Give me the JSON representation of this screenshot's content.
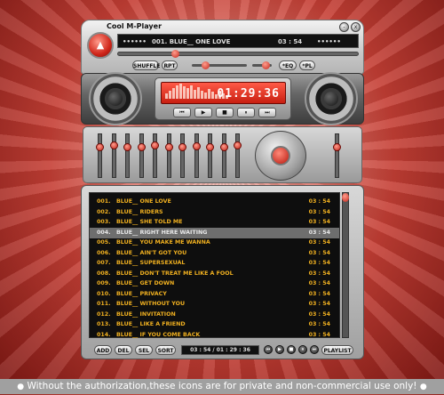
{
  "window": {
    "title": "Cool M-Player",
    "minimize_label": "-",
    "close_label": "x"
  },
  "now_playing": {
    "prefix": "••••••",
    "track_text": "001.  BLUE__  ONE LOVE",
    "time_text": "03 : 54",
    "suffix": "••••••"
  },
  "controls": {
    "shuffle_label": "SHUFFLE",
    "repeat_label": "RPT",
    "eq_label": "*EQ",
    "pl_label": "*PL",
    "eject_icon": "▲",
    "transport": [
      "⏮",
      "▶",
      "■",
      "⏸",
      "⏭"
    ]
  },
  "display": {
    "time": "01:29:36"
  },
  "seek": {
    "position_fraction": 0.23
  },
  "volume": {
    "fraction": 0.2
  },
  "balance": {
    "fraction": 0.85
  },
  "equalizer": {
    "bands": [
      0.25,
      0.2,
      0.25,
      0.25,
      0.2,
      0.25,
      0.25,
      0.22,
      0.25,
      0.25,
      0.2
    ],
    "preamp": 0.25
  },
  "playlist": {
    "tracks": [
      {
        "num": "001.",
        "title": "BLUE__  ONE LOVE",
        "duration": "03 : 54",
        "selected": false
      },
      {
        "num": "002.",
        "title": "BLUE__  RIDERS",
        "duration": "03 : 54",
        "selected": false
      },
      {
        "num": "003.",
        "title": "BLUE__  SHE TOLD ME",
        "duration": "03 : 54",
        "selected": false
      },
      {
        "num": "004.",
        "title": "BLUE__  RIGHT HERE WAITING",
        "duration": "03 : 54",
        "selected": true
      },
      {
        "num": "005.",
        "title": "BLUE__  YOU MAKE ME WANNA",
        "duration": "03 : 54",
        "selected": false
      },
      {
        "num": "006.",
        "title": "BLUE__  AIN'T GOT YOU",
        "duration": "03 : 54",
        "selected": false
      },
      {
        "num": "007.",
        "title": "BLUE__  SUPERSEXUAL",
        "duration": "03 : 54",
        "selected": false
      },
      {
        "num": "008.",
        "title": "BLUE__  DON'T TREAT ME LIKE A FOOL",
        "duration": "03 : 54",
        "selected": false
      },
      {
        "num": "009.",
        "title": "BLUE__  GET DOWN",
        "duration": "03 : 54",
        "selected": false
      },
      {
        "num": "010.",
        "title": "BLUE__  PRIVACY",
        "duration": "03 : 54",
        "selected": false
      },
      {
        "num": "011.",
        "title": "BLUE__  WITHOUT YOU",
        "duration": "03 : 54",
        "selected": false
      },
      {
        "num": "012.",
        "title": "BLUE__  INVITATION",
        "duration": "03 : 54",
        "selected": false
      },
      {
        "num": "013.",
        "title": "BLUE__  LIKE A FRIEND",
        "duration": "03 : 54",
        "selected": false
      },
      {
        "num": "014.",
        "title": "BLUE__  IF YOU COME BACK",
        "duration": "03 : 54",
        "selected": false
      }
    ],
    "scroll_fraction": 0.0,
    "buttons": {
      "add": "ADD",
      "del": "DEL",
      "sel": "SEL",
      "sort": "SORT",
      "playlist": "PLAYLIST"
    },
    "time_text": "03 : 54 / 01 : 29 : 36",
    "mini_transport": [
      "⏮",
      "▶",
      "■",
      "⏸",
      "⏭"
    ]
  },
  "banner": {
    "dot": "●",
    "text": "Without the authorization,these icons are for private and non-commercial use only!"
  },
  "colors": {
    "accent": "#d0261a",
    "track_text": "#f0b020",
    "selected_row": "#6e6e6e"
  }
}
